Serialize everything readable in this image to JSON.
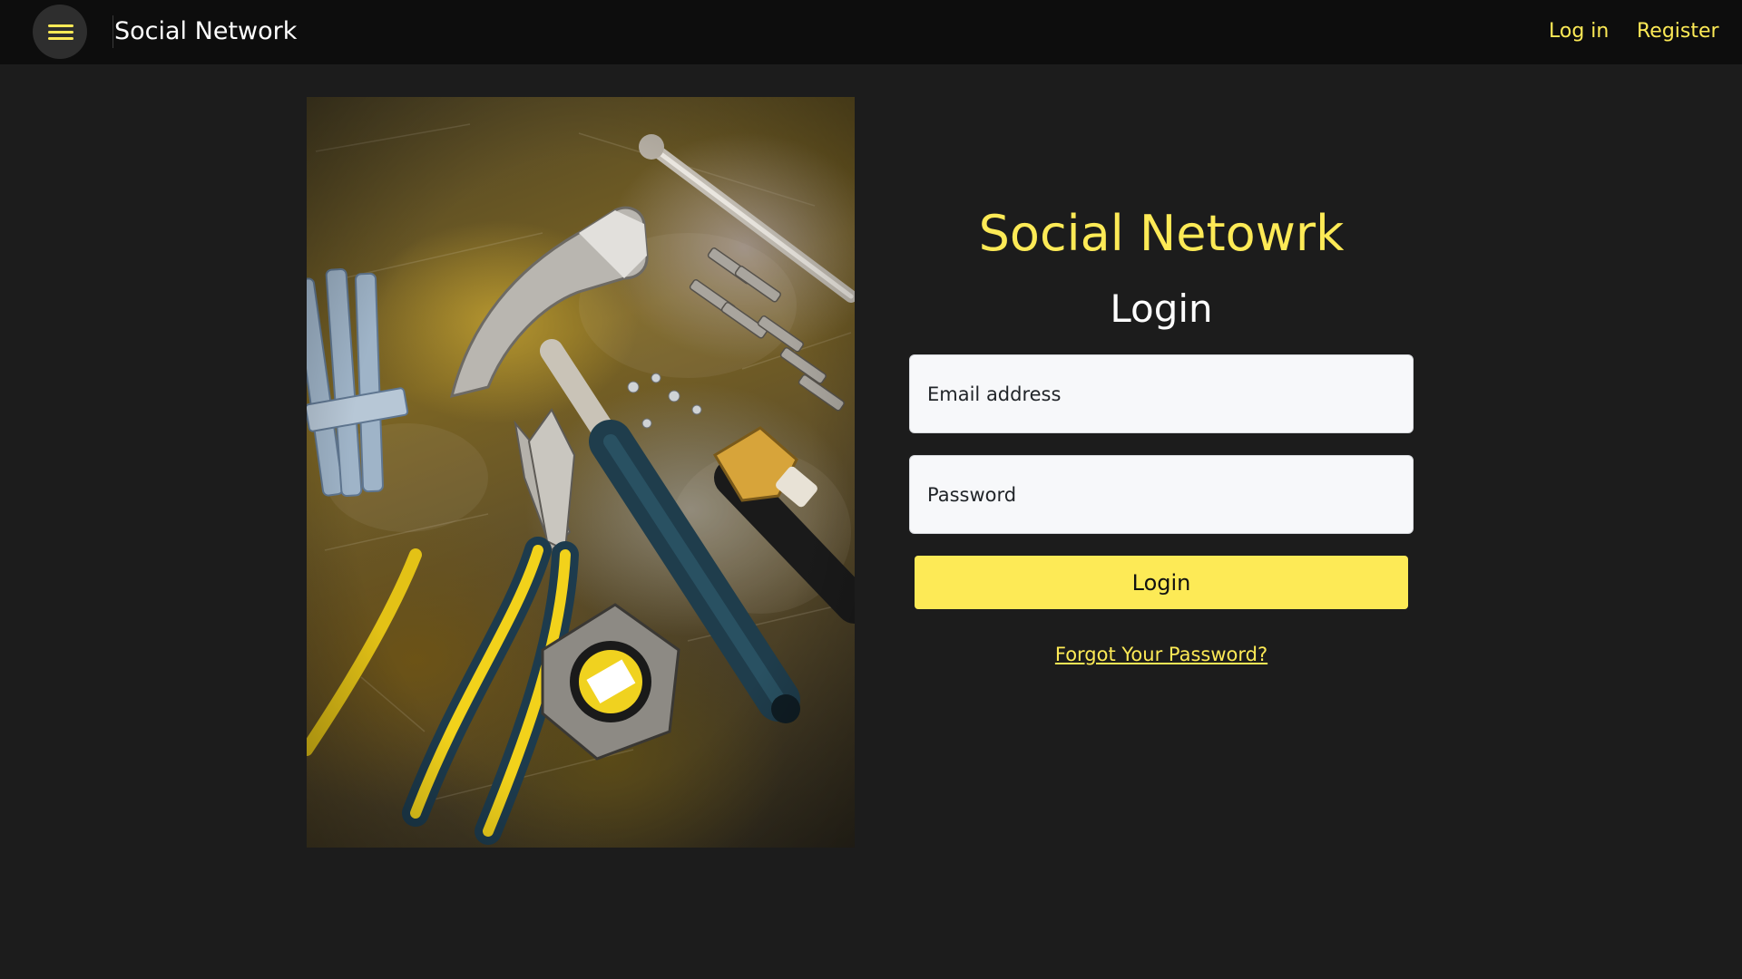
{
  "header": {
    "menu_icon": "hamburger-menu-icon",
    "brand": "Social Network",
    "nav": {
      "login": "Log in",
      "register": "Register"
    }
  },
  "hero": {
    "image": "tools-on-workbench-photo"
  },
  "login_form": {
    "site_title": "Social Netowrk",
    "heading": "Login",
    "email": {
      "label": "Email address",
      "value": ""
    },
    "password": {
      "label": "Password",
      "value": ""
    },
    "submit_label": "Login",
    "forgot_password": "Forgot Your Password?"
  },
  "colors": {
    "accent": "#fdea56",
    "topbar_bg": "#0d0d0d",
    "page_bg": "#1c1c1c",
    "input_bg": "#f7f8fa"
  }
}
